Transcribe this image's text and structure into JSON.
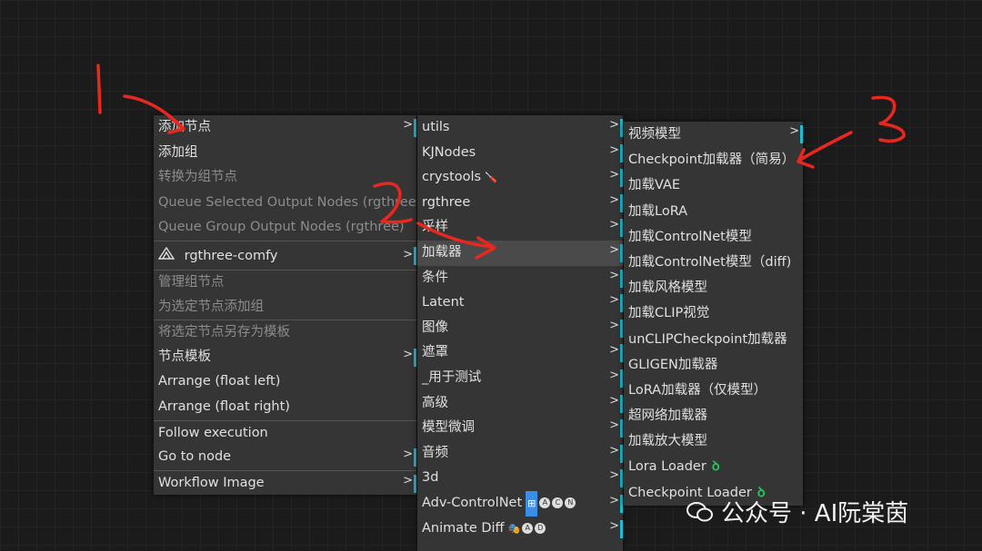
{
  "menu1": {
    "items": [
      {
        "label": "添加节点",
        "submenu": true,
        "bar": true
      },
      {
        "label": "添加组"
      },
      {
        "label": "转换为组节点",
        "disabled": true
      },
      {
        "label": "Queue Selected Output Nodes (rgthree)",
        "disabled": true
      },
      {
        "label": "Queue Group Output Nodes (rgthree)",
        "disabled": true
      },
      {
        "label": "rgthree-comfy",
        "submenu": true,
        "bar": true,
        "icon": "rgthree-logo-icon"
      },
      {
        "label": "管理组节点",
        "disabled": true
      },
      {
        "label": "为选定节点添加组",
        "disabled": true
      },
      {
        "label": "将选定节点另存为模板",
        "disabled": true
      },
      {
        "label": "节点模板",
        "submenu": true,
        "bar": true
      },
      {
        "label": "Arrange (float left)"
      },
      {
        "label": "Arrange (float right)"
      },
      {
        "label": "Follow execution"
      },
      {
        "label": "Go to node",
        "submenu": true,
        "bar": true
      },
      {
        "label": "Workflow Image",
        "submenu": true,
        "bar": true
      }
    ]
  },
  "menu2": {
    "items": [
      {
        "label": "utils"
      },
      {
        "label": "KJNodes"
      },
      {
        "label": "crystools",
        "emoji": "🪛"
      },
      {
        "label": "rgthree"
      },
      {
        "label": "采样"
      },
      {
        "label": "加载器",
        "active": true
      },
      {
        "label": "条件"
      },
      {
        "label": "Latent"
      },
      {
        "label": "图像"
      },
      {
        "label": "遮罩"
      },
      {
        "label": "_用于测试"
      },
      {
        "label": "高级"
      },
      {
        "label": "模型微调"
      },
      {
        "label": "音频"
      },
      {
        "label": "3d"
      },
      {
        "label": "Adv-ControlNet",
        "badges": [
          "A",
          "C",
          "N"
        ]
      },
      {
        "label": "Animate Diff",
        "badges": [
          "A",
          "D"
        ]
      }
    ]
  },
  "menu3": {
    "items": [
      {
        "label": "视频模型",
        "submenu": true
      },
      {
        "label": "Checkpoint加载器（简易）"
      },
      {
        "label": "加载VAE"
      },
      {
        "label": "加载LoRA"
      },
      {
        "label": "加载ControlNet模型"
      },
      {
        "label": "加载ControlNet模型（diff)"
      },
      {
        "label": "加载风格模型"
      },
      {
        "label": "加载CLIP视觉"
      },
      {
        "label": "unCLIPCheckpoint加载器"
      },
      {
        "label": "GLIGEN加载器"
      },
      {
        "label": "LoRA加载器（仅模型）"
      },
      {
        "label": "超网络加载器"
      },
      {
        "label": "加载放大模型"
      },
      {
        "label": "Lora Loader",
        "icon": "green-loop-icon"
      },
      {
        "label": "Checkpoint Loader",
        "icon": "green-loop-icon"
      }
    ]
  },
  "annotations": [
    "1",
    "2",
    "3"
  ],
  "watermark": {
    "text": "公众号 · AI阮棠茵"
  },
  "colors": {
    "accent_bar": "#19bfd4",
    "annotation": "#e8271f",
    "icon_green": "#29c45b"
  }
}
